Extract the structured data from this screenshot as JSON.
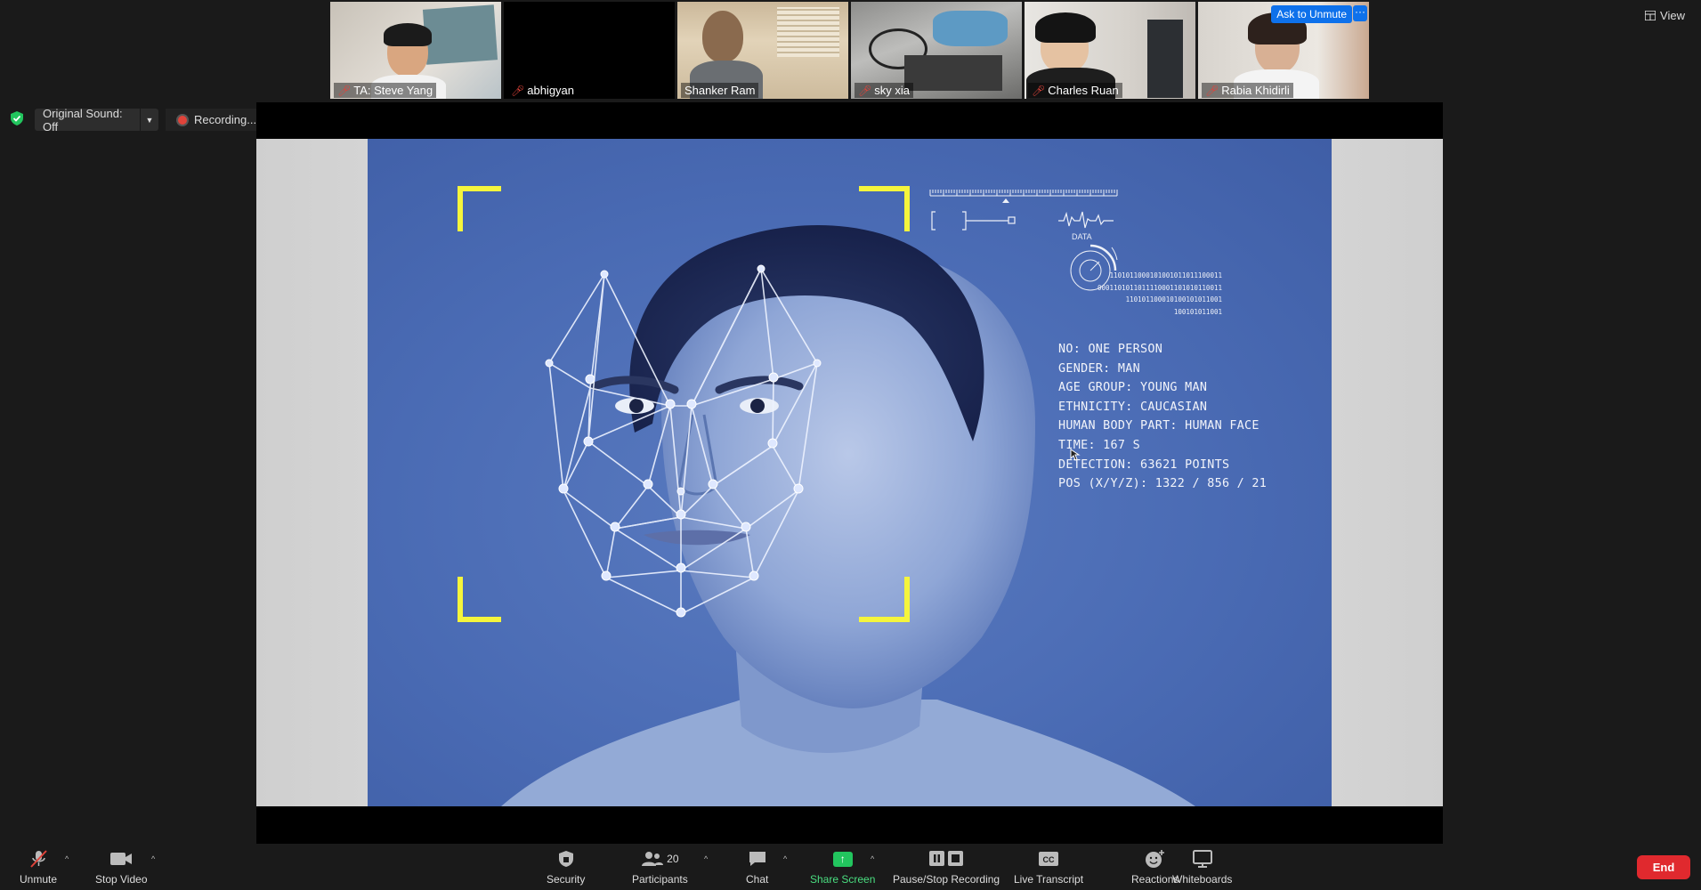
{
  "participants": [
    {
      "name": "TA: Steve Yang",
      "muted": true
    },
    {
      "name": "abhigyan",
      "muted": true
    },
    {
      "name": "Shanker Ram",
      "muted": false
    },
    {
      "name": "sky xia",
      "muted": true
    },
    {
      "name": "Charles Ruan",
      "muted": true
    },
    {
      "name": "Rabia Khidirli",
      "muted": true
    }
  ],
  "thumbnail_actions": {
    "ask_to_unmute": "Ask to Unmute",
    "more": "···"
  },
  "top_right": {
    "view_label": "View"
  },
  "recording_bar": {
    "original_sound": "Original Sound: Off",
    "recording_label": "Recording..."
  },
  "slide": {
    "data_label": "DATA",
    "binary_lines": [
      "1101011000101001011011100011",
      "0001101011011110001101010110011",
      "110101100010100101011001",
      "100101011001"
    ],
    "info_lines": [
      "NO: ONE PERSON",
      "GENDER: MAN",
      "AGE GROUP: YOUNG MAN",
      "ETHNICITY: CAUCASIAN",
      "HUMAN BODY PART: HUMAN FACE",
      "TIME: 167 S",
      "DETECTION: 63621 POINTS",
      "POS (X/Y/Z): 1322 / 856 / 21"
    ],
    "frame_color": "#f5f53c"
  },
  "toolbar": {
    "unmute": "Unmute",
    "stop_video": "Stop Video",
    "security": "Security",
    "participants": "Participants",
    "participants_count": "20",
    "chat": "Chat",
    "share_screen": "Share Screen",
    "pause_stop_recording": "Pause/Stop Recording",
    "live_transcript": "Live Transcript",
    "live_transcript_icon_text": "CC",
    "reactions": "Reactions",
    "whiteboards": "Whiteboards",
    "end": "End"
  },
  "colors": {
    "accent_blue": "#0e71eb",
    "share_green": "#22c55e",
    "end_red": "#e0292e",
    "muted_red": "#e0433a"
  }
}
